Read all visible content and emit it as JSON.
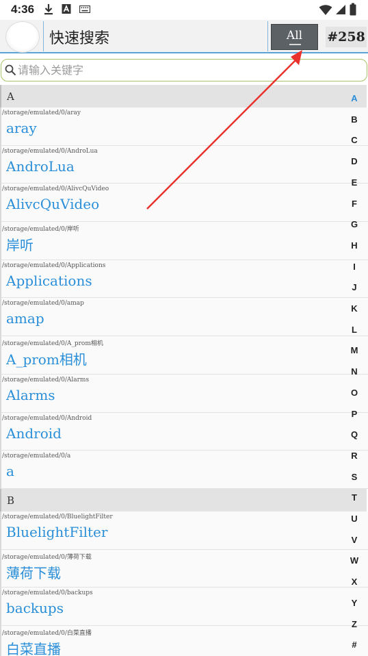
{
  "status_bar": {
    "time": "4:36",
    "left_icons": [
      "download-icon",
      "a-box-icon",
      "keyboard-icon"
    ],
    "right_icons": [
      "wifi-icon",
      "signal-icon",
      "battery-icon"
    ]
  },
  "header": {
    "title": "快速搜索",
    "filter_label": "All",
    "count": "#258"
  },
  "search": {
    "placeholder": "请输入关键字"
  },
  "list": {
    "section_a": "A",
    "section_b": "B",
    "items": [
      {
        "path": "/storage/emulated/0/aray",
        "name": "aray"
      },
      {
        "path": "/storage/emulated/0/AndroLua",
        "name": "AndroLua"
      },
      {
        "path": "/storage/emulated/0/AlivcQuVideo",
        "name": "AlivcQuVideo"
      },
      {
        "path": "/storage/emulated/0/岸听",
        "name": "岸听"
      },
      {
        "path": "/storage/emulated/0/Applications",
        "name": "Applications"
      },
      {
        "path": "/storage/emulated/0/amap",
        "name": "amap"
      },
      {
        "path": "/storage/emulated/0/A_prom相机",
        "name": "A_prom相机"
      },
      {
        "path": "/storage/emulated/0/Alarms",
        "name": "Alarms"
      },
      {
        "path": "/storage/emulated/0/Android",
        "name": "Android"
      },
      {
        "path": "/storage/emulated/0/a",
        "name": "a"
      },
      {
        "path": "/storage/emulated/0/BluelightFilter",
        "name": "BluelightFilter"
      },
      {
        "path": "/storage/emulated/0/薄荷下载",
        "name": "薄荷下载"
      },
      {
        "path": "/storage/emulated/0/backups",
        "name": "backups"
      },
      {
        "path": "/storage/emulated/0/白菜直播",
        "name": "白菜直播"
      }
    ]
  },
  "alphabet": {
    "letters": [
      "A",
      "B",
      "C",
      "D",
      "E",
      "F",
      "G",
      "H",
      "I",
      "J",
      "K",
      "L",
      "M",
      "N",
      "O",
      "P",
      "Q",
      "R",
      "S",
      "T",
      "U",
      "V",
      "W",
      "X",
      "Y",
      "Z",
      "#"
    ],
    "active": "A"
  },
  "colors": {
    "accent": "#2a8fd8",
    "arrow": "#e8322b",
    "search_border": "#a6c46a",
    "button_bg": "#5c6166"
  }
}
